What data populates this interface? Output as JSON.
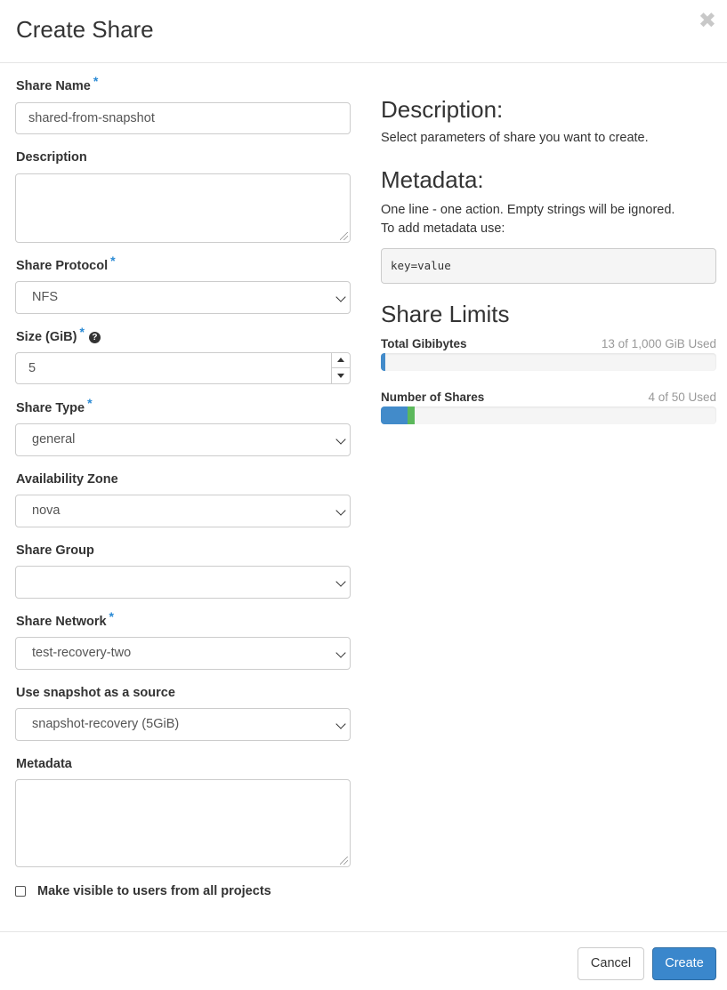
{
  "modal": {
    "title": "Create Share",
    "close_glyph": "✖"
  },
  "form": {
    "share_name": {
      "label": "Share Name",
      "required": "*",
      "value": "shared-from-snapshot"
    },
    "description": {
      "label": "Description",
      "value": ""
    },
    "share_protocol": {
      "label": "Share Protocol",
      "required": "*",
      "selected": "NFS"
    },
    "size": {
      "label": "Size (GiB)",
      "required": "*",
      "help_glyph": "?",
      "value": "5"
    },
    "share_type": {
      "label": "Share Type",
      "required": "*",
      "selected": "general"
    },
    "availability_zone": {
      "label": "Availability Zone",
      "selected": "nova"
    },
    "share_group": {
      "label": "Share Group",
      "selected": ""
    },
    "share_network": {
      "label": "Share Network",
      "required": "*",
      "selected": "test-recovery-two"
    },
    "snapshot_source": {
      "label": "Use snapshot as a source",
      "selected": "snapshot-recovery (5GiB)"
    },
    "metadata": {
      "label": "Metadata",
      "value": ""
    },
    "visible_all_projects": {
      "label": "Make visible to users from all projects",
      "checked": false
    }
  },
  "help": {
    "description_heading": "Description:",
    "description_text": "Select parameters of share you want to create.",
    "metadata_heading": "Metadata:",
    "metadata_text_1": "One line - one action. Empty strings will be ignored.",
    "metadata_text_2": "To add metadata use:",
    "metadata_example": "key=value",
    "limits_heading": "Share Limits"
  },
  "quotas": {
    "gibibytes": {
      "label": "Total Gibibytes",
      "used_text": "13 of 1,000 GiB Used",
      "used_fraction": 0.013,
      "color": "#428bca"
    },
    "shares": {
      "label": "Number of Shares",
      "used_text": "4 of 50 Used",
      "used_fraction": 0.08,
      "added_fraction": 0.02,
      "color": "#428bca",
      "added_color": "#5cb85c"
    }
  },
  "footer": {
    "cancel_label": "Cancel",
    "create_label": "Create"
  }
}
